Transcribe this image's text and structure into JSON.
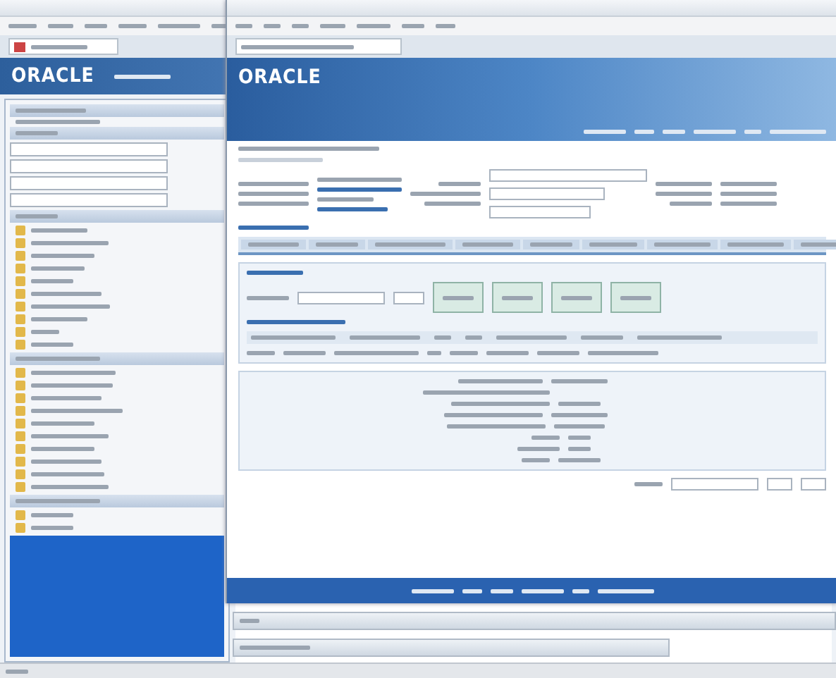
{
  "back_window": {
    "logo": "ORACLE"
  },
  "front_window": {
    "logo": "ORACLE"
  }
}
